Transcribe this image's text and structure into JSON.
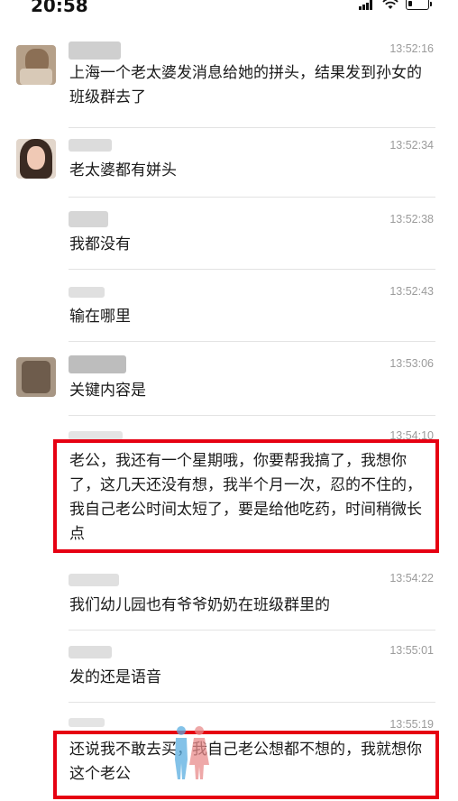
{
  "status_bar": {
    "time": "20:58"
  },
  "messages": [
    {
      "time": "13:52:16",
      "text": "上海一个老太婆发消息给她的拼头，结果发到孙女的班级群去了"
    },
    {
      "time": "13:52:34",
      "text": "老太婆都有姘头"
    },
    {
      "time": "13:52:38",
      "text": "我都没有"
    },
    {
      "time": "13:52:43",
      "text": "输在哪里"
    },
    {
      "time": "13:53:06",
      "text": "关键内容是"
    },
    {
      "time": "13:54:10",
      "text": "老公，我还有一个星期哦，你要帮我搞了，我想你了，这几天还没有想，我半个月一次，忍的不住的，我自己老公时间太短了，要是给他吃药，时间稍微长点"
    },
    {
      "time": "13:54:22",
      "text": "我们幼儿园也有爷爷奶奶在班级群里的"
    },
    {
      "time": "13:55:01",
      "text": "发的还是语音"
    },
    {
      "time": "13:55:19",
      "text": "还说我不敢去买，我自己老公想都不想的，我就想你这个老公"
    }
  ],
  "colors": {
    "highlight_box": "#e60012",
    "timestamp": "#9b9b9b",
    "separator": "#e3e3e3"
  }
}
